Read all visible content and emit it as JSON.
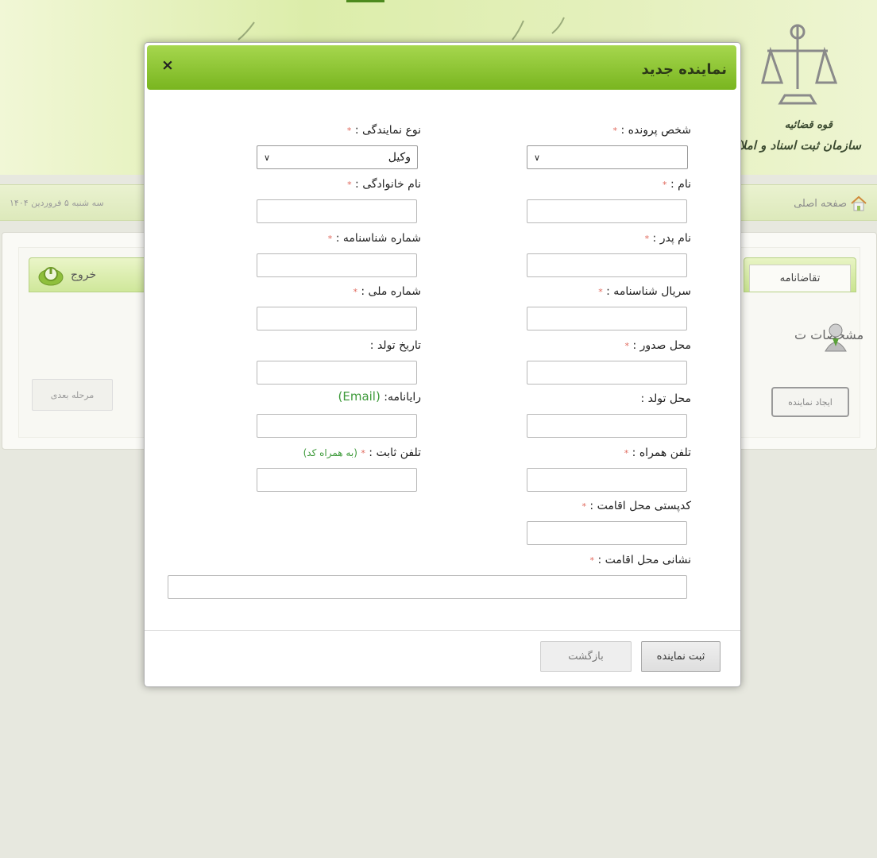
{
  "background": {
    "org_name": "سازمان ثبت اسناد و املاک کشور",
    "judiciary": "قوه قضائیه",
    "nav_home": "صفحه اصلی",
    "date": "سه شنبه ۵ فروردین ۱۴۰۴",
    "exit_tab": "خروج",
    "request_tab": "تقاضانامه",
    "specs_label": "مشخصات ت",
    "next_button": "مرحله بعدی",
    "create_rep_button": "ایجاد نماینده"
  },
  "modal": {
    "title": "نماینده جدید",
    "close_symbol": "×",
    "required_mark": "*",
    "fields": {
      "case_person": "شخص پرونده :",
      "rep_type": "نوع نمایندگی :",
      "rep_type_value": "وکیل",
      "first_name": "نام :",
      "last_name": "نام خانوادگی :",
      "father_name": "نام پدر :",
      "id_number": "شماره شناسنامه :",
      "id_serial": "سریال شناسنامه :",
      "national_code": "شماره ملی :",
      "issue_place": "محل صدور :",
      "birth_date": "تاریخ تولد :",
      "birth_place": "محل تولد :",
      "email": "رایانامه:",
      "email_hint": "(Email)",
      "mobile": "تلفن همراه :",
      "phone": "تلفن ثابت :",
      "phone_hint": "(به همراه کد)",
      "postal_code": "کدپستی محل اقامت :",
      "address": "نشانی محل اقامت :"
    },
    "buttons": {
      "submit": "ثبت نماینده",
      "back": "بازگشت"
    }
  },
  "colors": {
    "header_green": "#79b51f",
    "required_red": "#e0685c",
    "hint_green": "#3d9a3a"
  }
}
